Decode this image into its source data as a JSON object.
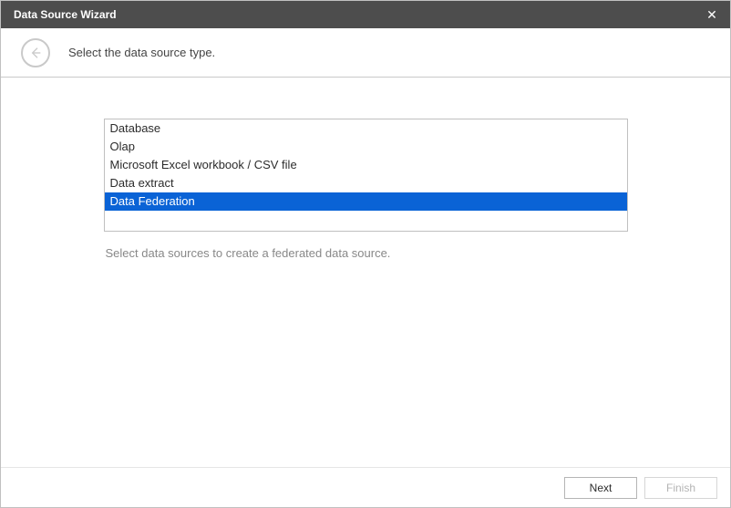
{
  "titlebar": {
    "title": "Data Source Wizard",
    "close_glyph": "✕"
  },
  "header": {
    "instruction": "Select the data source type."
  },
  "listbox": {
    "items": [
      {
        "label": "Database",
        "selected": false
      },
      {
        "label": "Olap",
        "selected": false
      },
      {
        "label": "Microsoft Excel workbook / CSV file",
        "selected": false
      },
      {
        "label": "Data extract",
        "selected": false
      },
      {
        "label": "Data Federation",
        "selected": true
      }
    ]
  },
  "description": "Select data sources to create a federated data source.",
  "buttons": {
    "next": "Next",
    "finish": "Finish"
  }
}
